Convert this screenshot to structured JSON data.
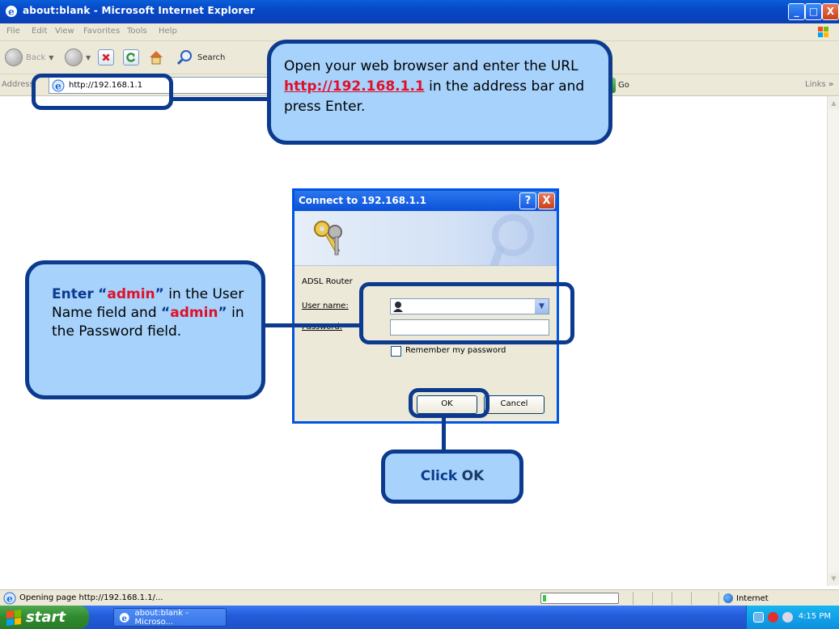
{
  "window": {
    "title": "about:blank - Microsoft Internet Explorer",
    "buttons": {
      "minimize": "_",
      "maximize": "□",
      "close": "X"
    }
  },
  "menubar": {
    "items": [
      "File",
      "Edit",
      "View",
      "Favorites",
      "Tools",
      "Help"
    ]
  },
  "toolbar": {
    "back_label": "Back",
    "search_label": "Search"
  },
  "addressbar": {
    "label": "Address",
    "value": "http://192.168.1.1",
    "go_label": "Go",
    "links_label": "Links"
  },
  "callouts": {
    "url": {
      "text_before": "Open your web browser and enter the URL ",
      "url": "http://192.168.1.1",
      "text_after": " in the address bar and press Enter."
    },
    "credentials": {
      "enter": "Enter",
      "q1_open": "“",
      "user": "admin",
      "q1_close": "”",
      "mid": " in the User Name field and ",
      "q2_open": "“",
      "pass": "admin",
      "q2_close": "”",
      "tail": " in the Password field."
    },
    "click": {
      "click": "Click",
      "ok": "OK"
    }
  },
  "dialog": {
    "title": "Connect to 192.168.1.1",
    "help_glyph": "?",
    "close_glyph": "X",
    "realm": "ADSL Router",
    "username_label": "User name:",
    "username_value": "",
    "password_label": "Password:",
    "password_value": "",
    "remember_label": "Remember my password",
    "remember_checked": false,
    "ok_label": "OK",
    "cancel_label": "Cancel"
  },
  "statusbar": {
    "text": "Opening page http://192.168.1.1/...",
    "progress": 0.04,
    "zone": "Internet"
  },
  "taskbar": {
    "start_label": "start",
    "task_label": "about:blank - Microso...",
    "clock": "4:15 PM"
  },
  "colors": {
    "callout_fill": "#a6d2fb",
    "callout_border": "#0b3a8e",
    "highlight_red": "#e0102a",
    "xp_blue": "#0054e3"
  },
  "icons": [
    "ie-icon",
    "back-icon",
    "forward-icon",
    "stop-icon",
    "refresh-icon",
    "home-icon",
    "search-icon",
    "go-arrow-icon",
    "keys-icon",
    "user-icon",
    "globe-icon",
    "windows-flag-icon"
  ]
}
